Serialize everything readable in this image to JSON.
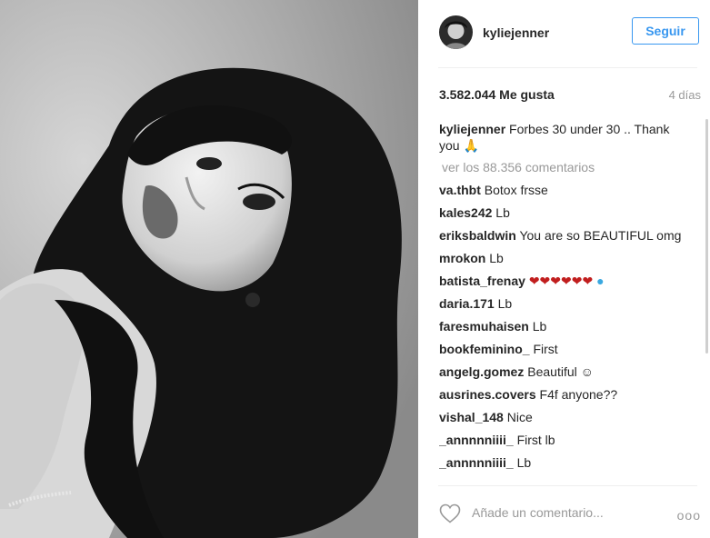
{
  "post": {
    "username": "kyliejenner",
    "follow_label": "Seguir",
    "likes": "3.582.044 Me gusta",
    "time_ago": "4 días",
    "caption": {
      "user": "kyliejenner",
      "text": "Forbes 30 under 30 .. Thank you 🙏"
    },
    "view_all_comments": "ver los 88.356 comentarios",
    "comments": [
      {
        "user": "va.thbt",
        "text": "Botox frsse"
      },
      {
        "user": "kales242",
        "text": "Lb"
      },
      {
        "user": "eriksbaldwin",
        "text": "You are so BEAUTIFUL omg"
      },
      {
        "user": "mrokon",
        "text": "Lb"
      },
      {
        "user": "batista_frenay",
        "text": "❤❤❤❤❤❤"
      },
      {
        "user": "daria.171",
        "text": "Lb"
      },
      {
        "user": "faresmuhaisen",
        "text": "Lb"
      },
      {
        "user": "bookfeminino_",
        "text": "First"
      },
      {
        "user": "angelg.gomez",
        "text": "Beautiful ☺"
      },
      {
        "user": "ausrines.covers",
        "text": "F4f anyone??"
      },
      {
        "user": "vishal_148",
        "text": "Nice"
      },
      {
        "user": "_annnnniiii_",
        "text": "First lb"
      },
      {
        "user": "_annnnniiii_",
        "text": "Lb"
      }
    ],
    "add_comment_placeholder": "Añade un comentario...",
    "more_options": "ooo"
  },
  "icons": {
    "like": "heart-outline-icon",
    "more": "more-options-icon"
  },
  "colors": {
    "accent": "#3897f0",
    "text": "#262626",
    "muted": "#999999",
    "divider": "#efefef"
  }
}
